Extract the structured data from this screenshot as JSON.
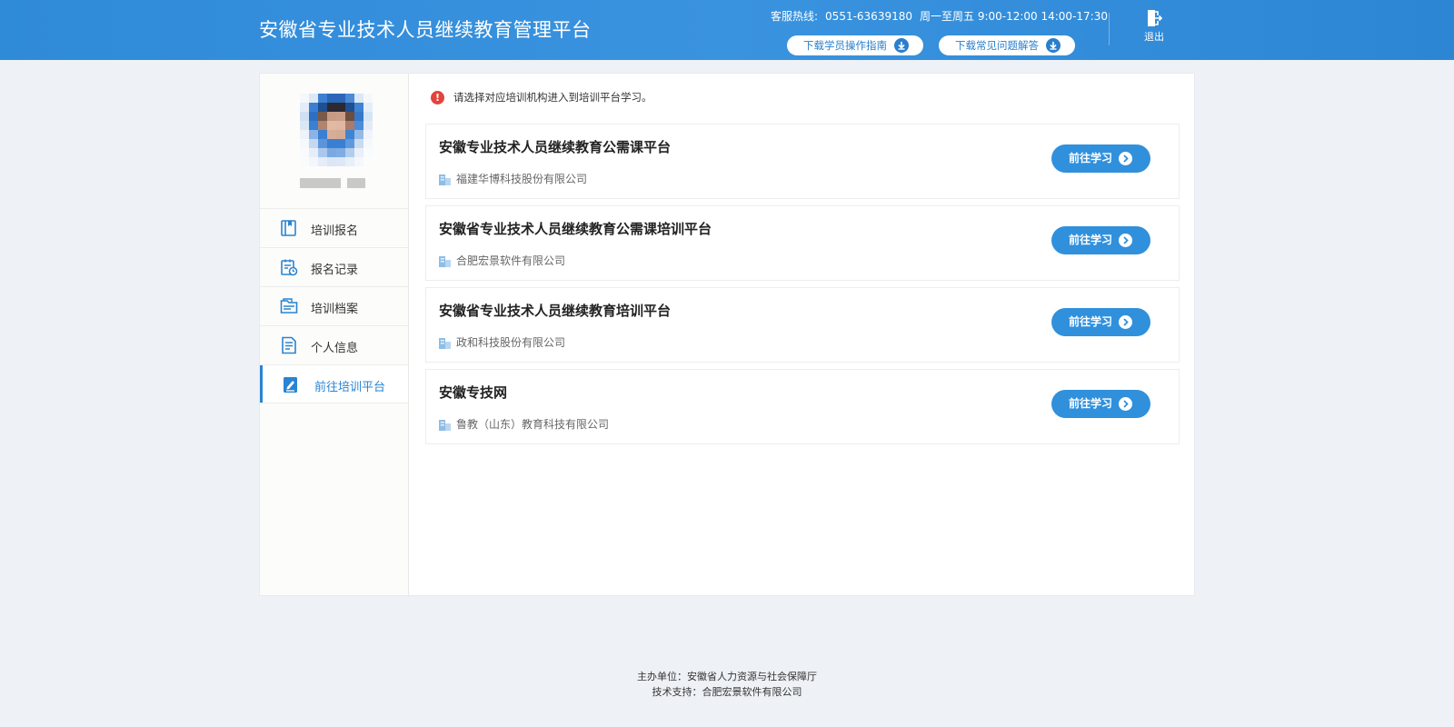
{
  "header": {
    "title": "安徽省专业技术人员继续教育管理平台",
    "hotline_label": "客服热线:",
    "hotline_number": "0551-63639180",
    "hotline_hours": "周一至周五 9:00-12:00 14:00-17:30",
    "download_guide": "下载学员操作指南",
    "download_faq": "下载常见问题解答",
    "logout": "退出"
  },
  "sidebar": {
    "items": [
      {
        "label": "培训报名",
        "icon": "book-icon"
      },
      {
        "label": "报名记录",
        "icon": "clipboard-clock-icon"
      },
      {
        "label": "培训档案",
        "icon": "folder-icon"
      },
      {
        "label": "个人信息",
        "icon": "document-icon"
      },
      {
        "label": "前往培训平台",
        "icon": "edit-clipboard-icon",
        "active": true
      }
    ]
  },
  "main": {
    "notice": "请选择对应培训机构进入到培训平台学习。",
    "go_label": "前往学习",
    "platforms": [
      {
        "title": "安徽专业技术人员继续教育公需课平台",
        "org": "福建华博科技股份有限公司"
      },
      {
        "title": "安徽省专业技术人员继续教育公需课培训平台",
        "org": "合肥宏景软件有限公司"
      },
      {
        "title": "安徽省专业技术人员继续教育培训平台",
        "org": "政和科技股份有限公司"
      },
      {
        "title": "安徽专技网",
        "org": "鲁教（山东）教育科技有限公司"
      }
    ]
  },
  "footer": {
    "sponsor": "主办单位：安徽省人力资源与社会保障厅",
    "support": "技术支持：合肥宏景软件有限公司"
  },
  "colors": {
    "header_blue": "#2f8ad8",
    "accent": "#3090dc",
    "warning": "#e0443c"
  }
}
